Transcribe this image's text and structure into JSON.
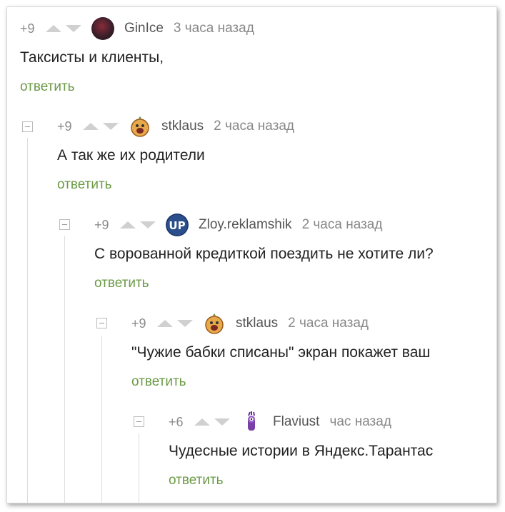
{
  "comments": [
    {
      "rating": "+9",
      "author": "GinIce",
      "time": "3 часа назад",
      "text": "Таксисты и клиенты,",
      "reply": "ответить",
      "avatar_color": "#3a1f2a"
    },
    {
      "rating": "+9",
      "author": "stklaus",
      "time": "2 часа назад",
      "text": "А так же их родители",
      "reply": "ответить",
      "avatar_color": "#e0a445"
    },
    {
      "rating": "+9",
      "author": "Zloy.reklamshik",
      "time": "2 часа назад",
      "text": "С ворованной кредиткой поездить не хотите ли?",
      "reply": "ответить",
      "avatar_color": "#2a4f8c",
      "avatar_text": "UP"
    },
    {
      "rating": "+9",
      "author": "stklaus",
      "time": "2 часа назад",
      "text": "\"Чужие бабки списаны\" экран покажет ваш",
      "reply": "ответить",
      "avatar_color": "#e0a445"
    },
    {
      "rating": "+6",
      "author": "Flaviust",
      "time": "час назад",
      "text": "Чудесные истории в Яндекс.Тарантас",
      "reply": "ответить",
      "avatar_color": "#7a3fa8"
    }
  ]
}
